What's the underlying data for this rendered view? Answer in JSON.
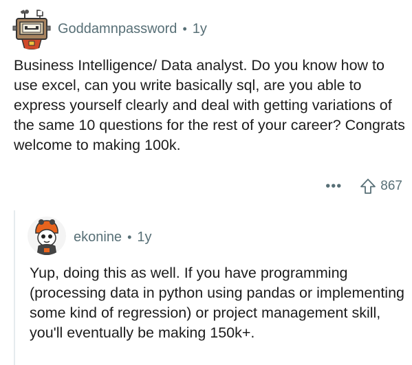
{
  "top_comment": {
    "username": "Goddamnpassword",
    "separator": "•",
    "age": "1y",
    "body": "Business Intelligence/ Data analyst.  Do you know how to use excel, can you write basically sql, are you able to express yourself clearly and deal with getting variations of the same 10 questions for the rest of your career? Congrats welcome to making 100k.",
    "more_label": "•••",
    "upvote_icon": "upvote-arrow-icon",
    "vote_count": "867"
  },
  "reply": {
    "username": "ekonine",
    "separator": "•",
    "age": "1y",
    "body": "Yup, doing this as well. If you have programming (processing data in python using pandas or implementing some kind of regression) or project management skill, you'll eventually be making 150k+."
  },
  "colors": {
    "text": "#1c1c1c",
    "meta": "#576f76",
    "thread_line": "#e5ebee"
  }
}
